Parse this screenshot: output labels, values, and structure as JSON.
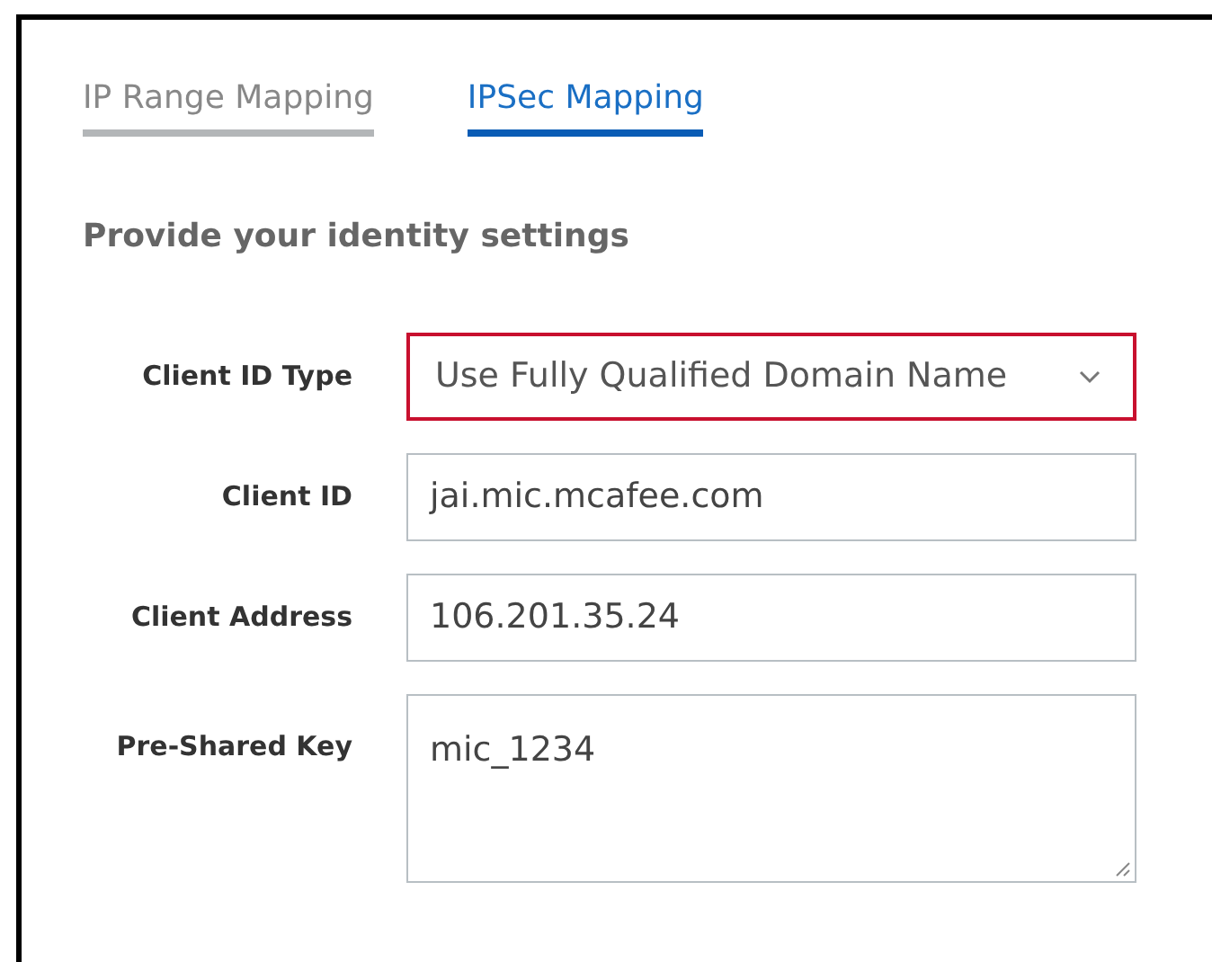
{
  "tabs": [
    {
      "label": "IP Range Mapping",
      "selected": false
    },
    {
      "label": "IPSec Mapping",
      "selected": true
    }
  ],
  "heading": "Provide your identity settings",
  "fields": [
    {
      "label": "Client ID Type",
      "kind": "select",
      "value": "Use Fully Qualified Domain Name",
      "invalid": true
    },
    {
      "label": "Client ID",
      "kind": "text",
      "value": "jai.mic.mcafee.com",
      "invalid": false
    },
    {
      "label": "Client Address",
      "kind": "text",
      "value": "106.201.35.24",
      "invalid": false
    },
    {
      "label": "Pre-Shared Key",
      "kind": "textarea",
      "value": "mic_1234",
      "invalid": false
    }
  ]
}
